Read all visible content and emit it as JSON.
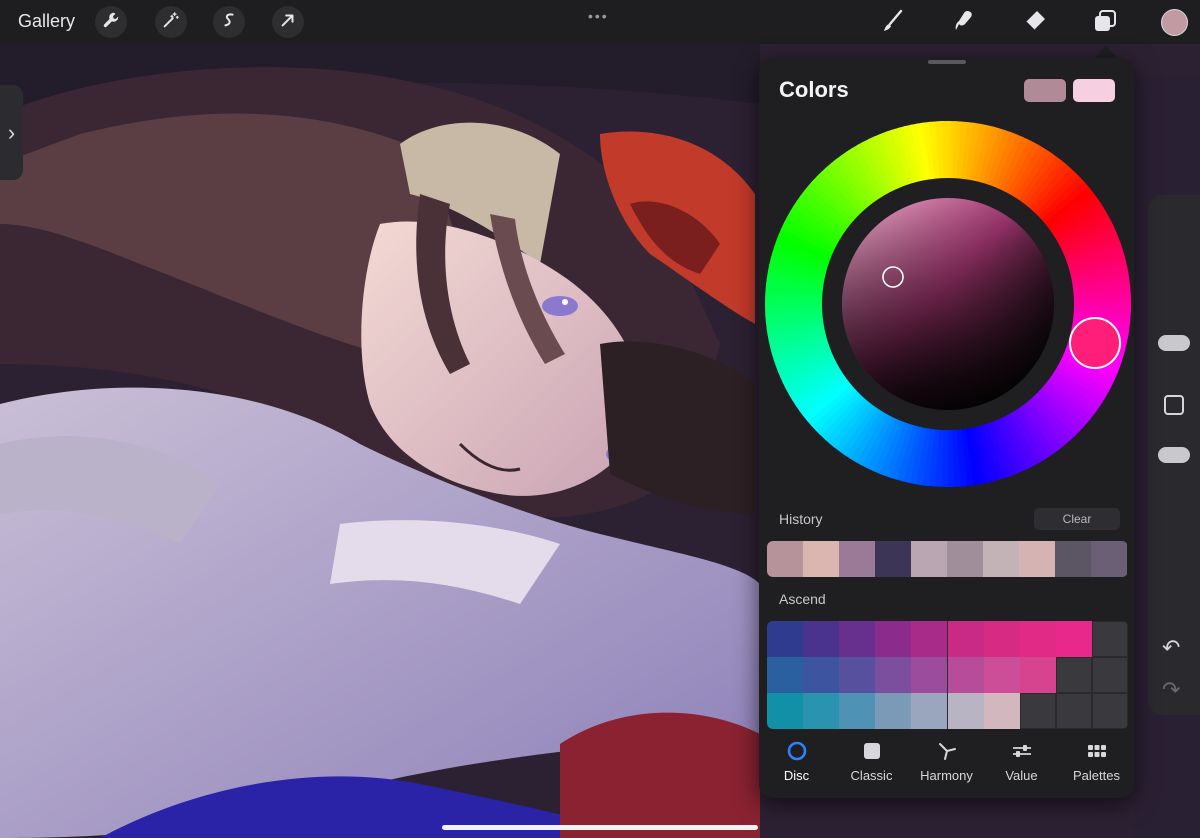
{
  "toolbar": {
    "gallery_label": "Gallery",
    "tools_left": [
      "wrench-icon",
      "magic-wand-icon",
      "selection-s-icon",
      "move-arrow-icon"
    ],
    "more_glyph": "•••",
    "tools_right": [
      "brush-icon",
      "smudge-icon",
      "eraser-icon",
      "layers-icon"
    ],
    "current_color": "#c29aa2"
  },
  "side_tab": {
    "glyph": "›"
  },
  "colors_panel": {
    "title": "Colors",
    "primary_swatch": "#b08a96",
    "secondary_swatch": "#f6cfe0",
    "selected_hue": "#ff1f7a",
    "history_label": "History",
    "clear_label": "Clear",
    "history": [
      "#b6929a",
      "#dbb6b1",
      "#9a7a96",
      "#3c3556",
      "#b9a6b2",
      "#a08f9a",
      "#c3b3b6",
      "#d5b3b3",
      "#5c5563",
      "#6b5f76"
    ],
    "palette_name": "Ascend",
    "palette": [
      [
        "#2e3b8e",
        "#4a338e",
        "#67308f",
        "#8b2b8c",
        "#a82b8a",
        "#c82a86",
        "#d62a83",
        "#e02a86",
        "#e8288a",
        "#3a3a3e"
      ],
      [
        "#2a5fa0",
        "#3d55a0",
        "#56509e",
        "#7b4f9e",
        "#9c4c9c",
        "#b64c9a",
        "#cc4d98",
        "#d6438e",
        "#3a3a3e",
        "#3a3a3e"
      ],
      [
        "#1190a8",
        "#2a93b0",
        "#4e93b5",
        "#7a9ab8",
        "#9aa6bd",
        "#b8b4c4",
        "#d3b7bf",
        "#3a3a3e",
        "#3a3a3e",
        "#3a3a3e"
      ]
    ],
    "mode_tabs": [
      {
        "label": "Disc",
        "icon": "disc-icon",
        "active": true
      },
      {
        "label": "Classic",
        "icon": "classic-square-icon",
        "active": false
      },
      {
        "label": "Harmony",
        "icon": "harmony-icon",
        "active": false
      },
      {
        "label": "Value",
        "icon": "sliders-icon",
        "active": false
      },
      {
        "label": "Palettes",
        "icon": "palettes-grid-icon",
        "active": false
      }
    ]
  },
  "right_rail": {
    "undo_glyph": "↶",
    "redo_glyph": "↷"
  }
}
